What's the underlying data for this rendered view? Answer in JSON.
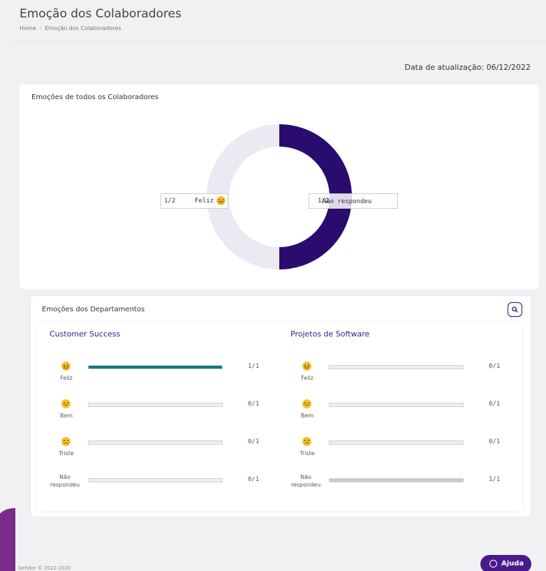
{
  "page": {
    "title": "Emoção dos Colaboradores"
  },
  "breadcrumb": {
    "home": "Home",
    "separator": "/",
    "current": "Emoção dos Colaboradores"
  },
  "update": {
    "text": "Data de atualização: 06/12/2022"
  },
  "overall": {
    "title": "Emoções de todos os Colaboradores",
    "chart_data": {
      "type": "pie",
      "slices": [
        {
          "label": "Feliz",
          "fraction": "1/2",
          "value": 1,
          "color": "#2a0b6e",
          "icon": "grin-emoji-icon"
        },
        {
          "label": "Não respondeu",
          "fraction": "1/2",
          "value": 1,
          "color": "#ece9f2"
        }
      ]
    }
  },
  "departments": {
    "title": "Emoções dos Departamentos",
    "items": [
      {
        "name": "Customer Success",
        "rows": [
          {
            "label": "Feliz",
            "icon": "grin-emoji-icon",
            "count": "1/1",
            "ratio": 1,
            "color": "#127880"
          },
          {
            "label": "Bem",
            "icon": "smile-emoji-icon",
            "count": "0/1",
            "ratio": 0,
            "color": "#127880"
          },
          {
            "label": "Triste",
            "icon": "sad-emoji-icon",
            "count": "0/1",
            "ratio": 0,
            "color": "#127880"
          },
          {
            "label": "Não respondeu",
            "icon": "",
            "count": "0/1",
            "ratio": 0,
            "color": "#cbcbcb"
          }
        ]
      },
      {
        "name": "Projetos de Software",
        "rows": [
          {
            "label": "Feliz",
            "icon": "grin-emoji-icon",
            "count": "0/1",
            "ratio": 0,
            "color": "#127880"
          },
          {
            "label": "Bem",
            "icon": "smile-emoji-icon",
            "count": "0/1",
            "ratio": 0,
            "color": "#127880"
          },
          {
            "label": "Triste",
            "icon": "sad-emoji-icon",
            "count": "0/1",
            "ratio": 0,
            "color": "#127880"
          },
          {
            "label": "Não respondeu",
            "icon": "",
            "count": "1/1",
            "ratio": 1,
            "color": "#cbcbcb"
          }
        ]
      }
    ]
  },
  "footer": {
    "text": "Gefidor © 2022-2020"
  },
  "help": {
    "label": "Ajuda"
  }
}
